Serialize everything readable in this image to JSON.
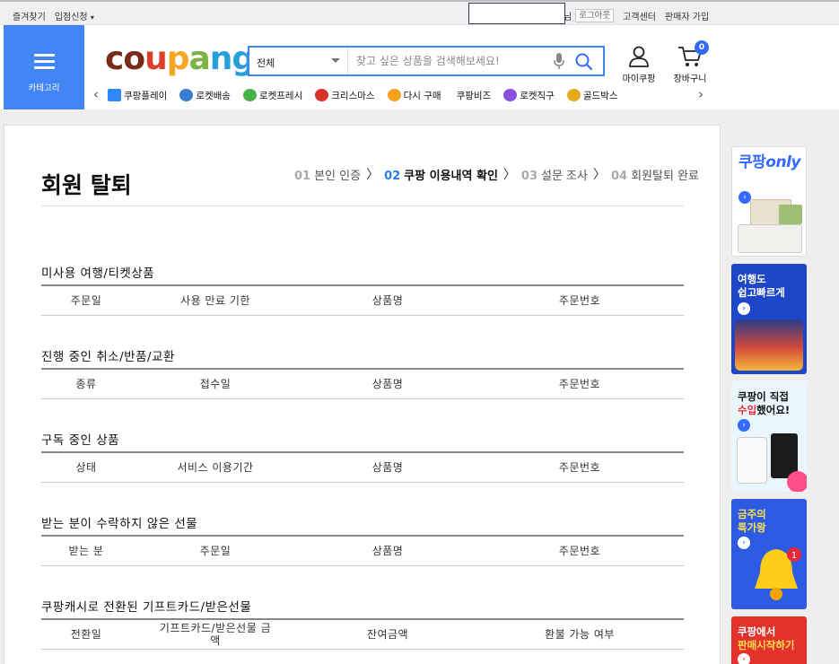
{
  "topbar": {
    "favorites": "즐겨찾기",
    "vendor_signup": "입점신청",
    "user_suffix": "님",
    "logout": "로그아웃",
    "customer_center": "고객센터",
    "seller_join": "판매자 가입"
  },
  "header": {
    "category_label": "카테고리",
    "logo": {
      "c1": "co",
      "c2": "u",
      "c3": "p",
      "c4": "a",
      "c5": "ng"
    },
    "search": {
      "category_value": "전체",
      "placeholder": "찾고 싶은 상품을 검색해보세요!"
    },
    "my_coupang": "마이쿠팡",
    "cart_label": "장바구니",
    "cart_count": "0",
    "quick_menu": [
      {
        "label": "쿠팡플레이",
        "icon": "play-icon"
      },
      {
        "label": "로켓배송",
        "icon": "rocket-icon"
      },
      {
        "label": "로켓프레시",
        "icon": "rocket-fresh-icon"
      },
      {
        "label": "크리스마스",
        "icon": "santa-icon"
      },
      {
        "label": "다시 구매",
        "icon": "home-icon"
      },
      {
        "label": "쿠팡비즈",
        "icon": "biz-icon"
      },
      {
        "label": "로켓직구",
        "icon": "global-icon"
      },
      {
        "label": "골드박스",
        "icon": "goldbox-icon"
      }
    ]
  },
  "page": {
    "title": "회원 탈퇴",
    "steps": [
      {
        "num": "01",
        "label": "본인 인증",
        "current": false
      },
      {
        "num": "02",
        "label": "쿠팡 이용내역 확인",
        "current": true
      },
      {
        "num": "03",
        "label": "설문 조사",
        "current": false
      },
      {
        "num": "04",
        "label": "회원탈퇴 완료",
        "current": false
      }
    ],
    "sections": [
      {
        "title": "미사용 여행/티켓상품",
        "cols": [
          "주문일",
          "사용 만료 기한",
          "상품명",
          "주문번호"
        ]
      },
      {
        "title": "진행 중인 취소/반품/교환",
        "cols": [
          "종류",
          "접수일",
          "상품명",
          "주문번호"
        ]
      },
      {
        "title": "구독 중인 상품",
        "cols": [
          "상태",
          "서비스 이용기간",
          "상품명",
          "주문번호"
        ]
      },
      {
        "title": "받는 분이 수락하지 않은 선물",
        "cols": [
          "받는 분",
          "주문일",
          "상품명",
          "주문번호"
        ]
      },
      {
        "title": "쿠팡캐시로 전환된 기프트카드/받은선물",
        "cols": [
          "전환일",
          "기프트카드/받은선물 금액",
          "잔여금액",
          "환불 가능 여부"
        ]
      }
    ]
  },
  "ads": [
    {
      "text_1": "쿠팡",
      "text_2": "only",
      "bg": "#ffffff",
      "accent": "#346aff"
    },
    {
      "text_1": "여행도",
      "text_2": "쉽고빠르게",
      "bg": "#1d46c8",
      "accent": "#ffffff"
    },
    {
      "text_1": "쿠팡이 직접",
      "text_2_a": "수입",
      "text_2_b": "했어요!",
      "bg": "#e9f7fd",
      "accent": "#e62e2e"
    },
    {
      "text_1": "금주의",
      "text_2": "특가왕",
      "bg": "#2d5be3",
      "accent": "#ffe14d"
    },
    {
      "text_1": "쿠팡에서",
      "text_2": "판매시작하기",
      "bg": "#e4312b",
      "accent": "#ffe14d"
    }
  ]
}
